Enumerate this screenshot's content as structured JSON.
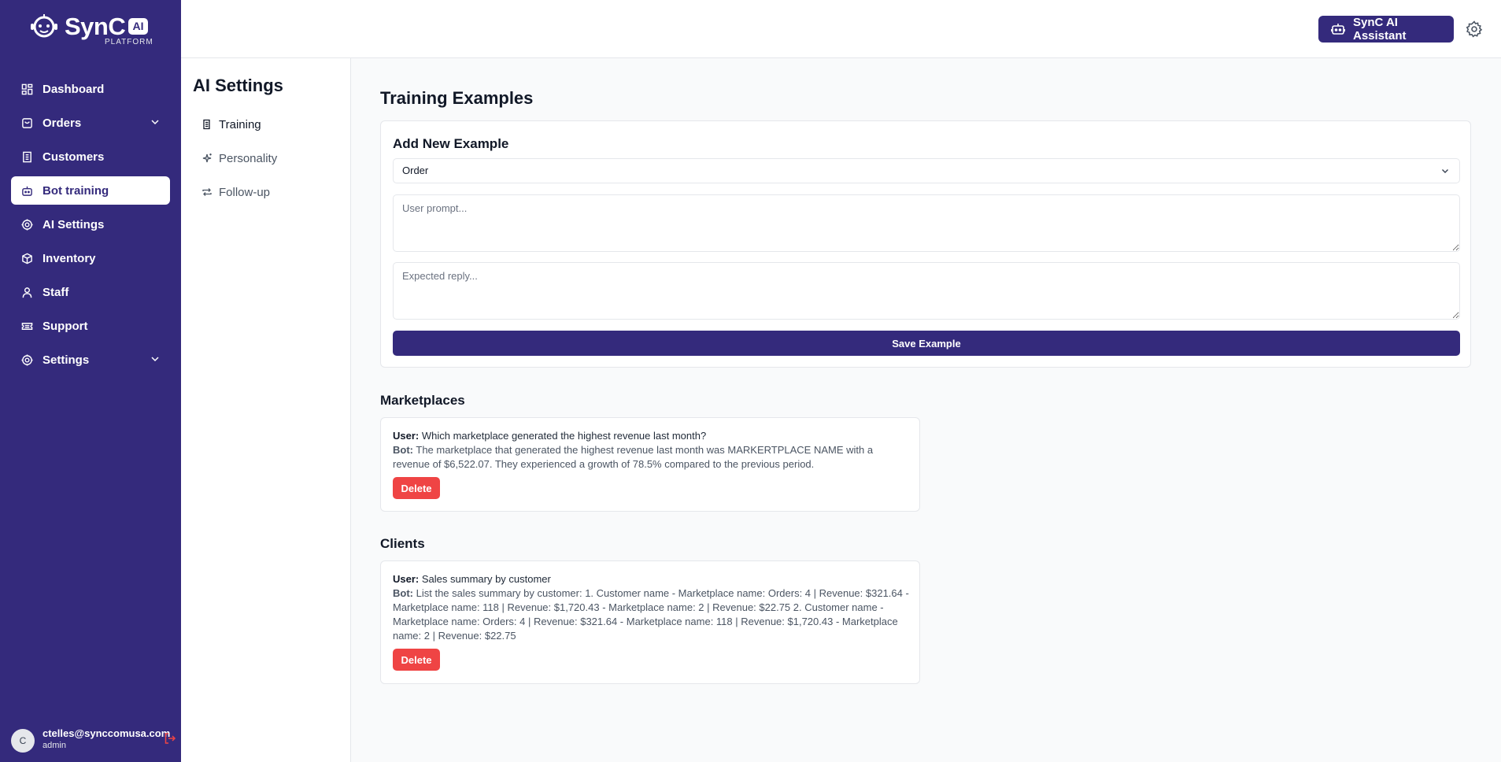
{
  "brand": {
    "name": "SynC",
    "badge": "AI",
    "sub": "PLATFORM"
  },
  "sidebar": {
    "items": [
      {
        "label": "Dashboard",
        "icon": "dashboard-icon"
      },
      {
        "label": "Orders",
        "icon": "bag-icon",
        "expandable": true
      },
      {
        "label": "Customers",
        "icon": "building-icon"
      },
      {
        "label": "Bot training",
        "icon": "bot-icon",
        "active": true
      },
      {
        "label": "AI Settings",
        "icon": "gear-icon"
      },
      {
        "label": "Inventory",
        "icon": "box-icon"
      },
      {
        "label": "Staff",
        "icon": "user-icon"
      },
      {
        "label": "Support",
        "icon": "ticket-icon"
      },
      {
        "label": "Settings",
        "icon": "gear-icon",
        "expandable": true
      }
    ],
    "user": {
      "initial": "C",
      "email": "ctelles@synccomusa.com",
      "role": "admin"
    }
  },
  "header": {
    "assistant_label": "SynC AI Assistant"
  },
  "settings_nav": {
    "title": "AI Settings",
    "items": [
      {
        "label": "Training",
        "icon": "document-icon",
        "active": true
      },
      {
        "label": "Personality",
        "icon": "sparkles-icon"
      },
      {
        "label": "Follow-up",
        "icon": "repeat-icon"
      }
    ]
  },
  "main": {
    "title": "Training Examples",
    "add_form": {
      "title": "Add New Example",
      "category_selected": "Order",
      "prompt_placeholder": "User prompt...",
      "reply_placeholder": "Expected reply...",
      "save_label": "Save Example"
    },
    "sections": [
      {
        "title": "Marketplaces",
        "examples": [
          {
            "user_label": "User:",
            "user_text": "Which marketplace generated the highest revenue last month?",
            "bot_label": "Bot:",
            "bot_text": "The marketplace that generated the highest revenue last month was MARKERTPLACE NAME with a revenue of $6,522.07. They experienced a growth of 78.5% compared to the previous period.",
            "delete_label": "Delete"
          }
        ]
      },
      {
        "title": "Clients",
        "examples": [
          {
            "user_label": "User:",
            "user_text": "Sales summary by customer",
            "bot_label": "Bot:",
            "bot_text": "List the sales summary by customer: 1. Customer name - Marketplace name: Orders: 4 | Revenue: $321.64 - Marketplace name: 118 | Revenue: $1,720.43 - Marketplace name: 2 | Revenue: $22.75 2. Customer name - Marketplace name: Orders: 4 | Revenue: $321.64 - Marketplace name: 118 | Revenue: $1,720.43 - Marketplace name: 2 | Revenue: $22.75",
            "delete_label": "Delete"
          }
        ]
      }
    ]
  },
  "colors": {
    "brand": "#342a7c",
    "danger": "#ef4444",
    "background": "#f9fafb"
  }
}
